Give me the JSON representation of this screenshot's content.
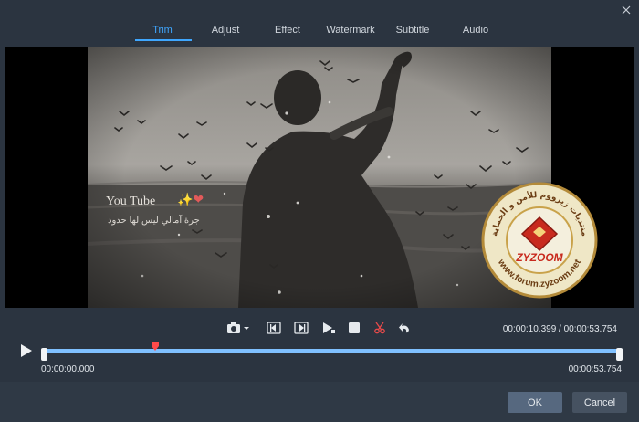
{
  "tabs": [
    {
      "label": "Trim",
      "active": true
    },
    {
      "label": "Adjust",
      "active": false
    },
    {
      "label": "Effect",
      "active": false
    },
    {
      "label": "Watermark",
      "active": false
    },
    {
      "label": "Subtitle",
      "active": false
    },
    {
      "label": "Audio",
      "active": false
    }
  ],
  "preview": {
    "overlay_text_line1": "You Tube",
    "overlay_text_line2": "جرة آمالي ليس لها حدود",
    "watermark": {
      "brand": "ZYZOOM",
      "arc_text_top": "منتديات زيزووم للأمن و الحماية",
      "arc_text_bottom": "www.forum.zyzoom.net"
    }
  },
  "controls": {
    "current_time": "00:00:10.399",
    "separator": " / ",
    "total_time": "00:00:53.754",
    "start_time": "00:00:00.000",
    "end_time": "00:00:53.754",
    "progress_fraction": 0.193,
    "icons": [
      "camera-icon",
      "dropdown-caret-icon",
      "prev-frame-icon",
      "next-frame-icon",
      "play-segment-icon",
      "stop-icon",
      "cut-icon",
      "undo-icon"
    ]
  },
  "footer": {
    "ok_label": "OK",
    "cancel_label": "Cancel"
  },
  "colors": {
    "accent": "#3fa7ff",
    "background": "#2b3440",
    "cut_red": "#e84a4a",
    "playhead_red": "#ff4a4a"
  }
}
